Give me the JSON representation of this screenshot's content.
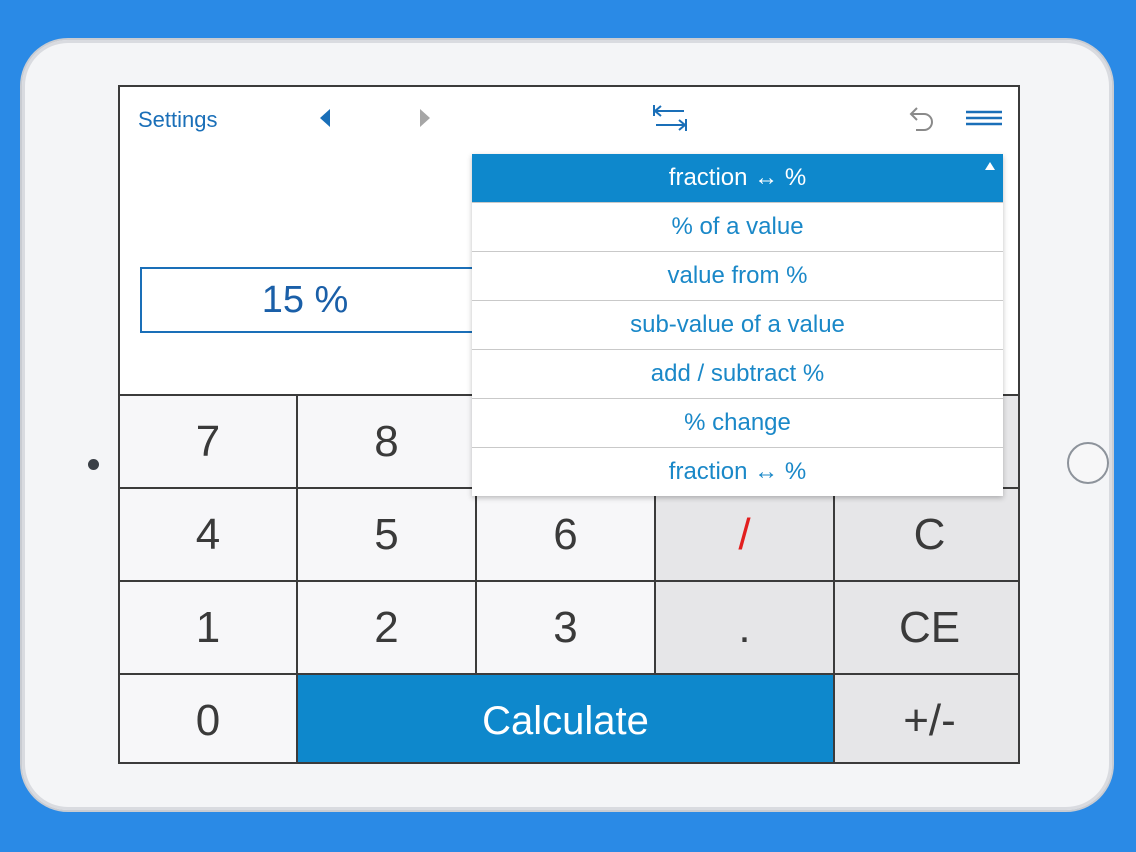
{
  "toolbar": {
    "settings_label": "Settings",
    "prev_icon": "triangle-left-icon",
    "next_icon": "triangle-right-icon",
    "swap_icon": "swap-arrows-icon",
    "undo_icon": "undo-icon",
    "menu_icon": "hamburger-menu-icon"
  },
  "display": {
    "value": "15 %"
  },
  "dropdown": {
    "selected": "fraction ↔ %",
    "options": [
      "% of a value",
      "value from %",
      "sub-value of a value",
      "add / subtract %",
      "% change",
      "fraction ↔ %"
    ]
  },
  "keypad": {
    "k7": "7",
    "k8": "8",
    "k4": "4",
    "k5": "5",
    "k6": "6",
    "divide": "/",
    "clear": "C",
    "k1": "1",
    "k2": "2",
    "k3": "3",
    "dot": ".",
    "clear_entry": "CE",
    "k0": "0",
    "calculate": "Calculate",
    "plus_minus": "+/-"
  },
  "colors": {
    "accent": "#0e88cc",
    "background": "#2a8ae6",
    "operator": "#e21f1f"
  }
}
